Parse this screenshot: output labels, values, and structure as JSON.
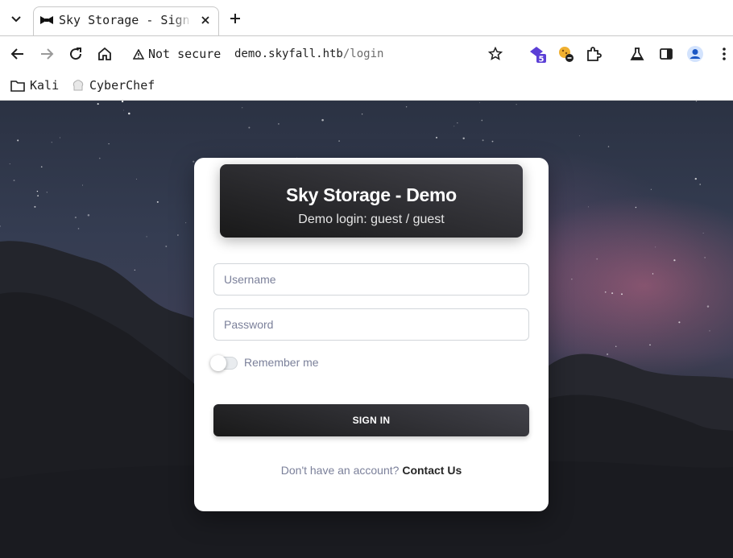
{
  "browser": {
    "tab": {
      "title": "Sky Storage - Sign In"
    },
    "security_label": "Not secure",
    "url": {
      "host": "demo.skyfall.htb",
      "path": "/login"
    },
    "extension_badge": "5",
    "bookmarks": [
      {
        "label": "Kali",
        "icon": "folder-icon"
      },
      {
        "label": "CyberChef",
        "icon": "cyberchef-icon"
      }
    ]
  },
  "card": {
    "title": "Sky Storage - Demo",
    "subtitle": "Demo login: guest / guest"
  },
  "form": {
    "username": {
      "value": "",
      "placeholder": "Username"
    },
    "password": {
      "value": "",
      "placeholder": "Password"
    },
    "remember_label": "Remember me",
    "remember_checked": false,
    "submit_label": "SIGN IN",
    "footer_text": "Don't have an account?",
    "footer_link": "Contact Us"
  },
  "colors": {
    "header_gradient_start": "#42424a",
    "header_gradient_end": "#191919",
    "muted_text": "#7b809a"
  }
}
